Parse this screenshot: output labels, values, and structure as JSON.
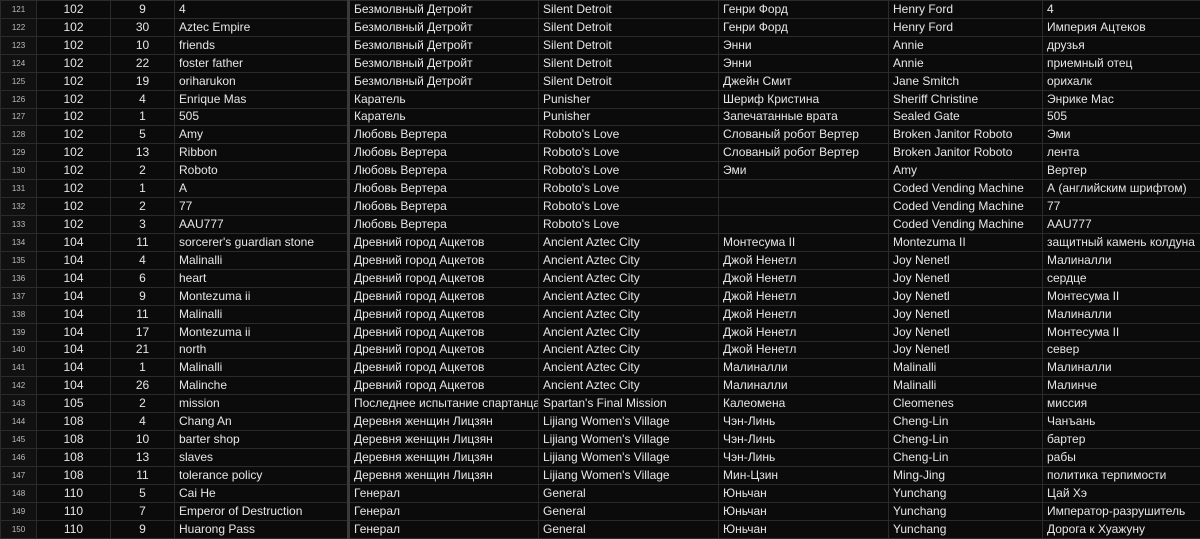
{
  "rows": [
    {
      "n": "121",
      "a": "102",
      "b": "9",
      "c": "4",
      "d": "Безмолвный Детройт",
      "e": "Silent Detroit",
      "f": "Генри Форд",
      "g": "Henry Ford",
      "h": "4"
    },
    {
      "n": "122",
      "a": "102",
      "b": "30",
      "c": "Aztec Empire",
      "d": "Безмолвный Детройт",
      "e": "Silent Detroit",
      "f": "Генри Форд",
      "g": "Henry Ford",
      "h": "Империя Ацтеков"
    },
    {
      "n": "123",
      "a": "102",
      "b": "10",
      "c": "friends",
      "d": "Безмолвный Детройт",
      "e": "Silent Detroit",
      "f": "Энни",
      "g": "Annie",
      "h": "друзья"
    },
    {
      "n": "124",
      "a": "102",
      "b": "22",
      "c": "foster father",
      "d": "Безмолвный Детройт",
      "e": "Silent Detroit",
      "f": "Энни",
      "g": "Annie",
      "h": "приемный отец"
    },
    {
      "n": "125",
      "a": "102",
      "b": "19",
      "c": "oriharukon",
      "d": "Безмолвный Детройт",
      "e": "Silent Detroit",
      "f": "Джейн Смит",
      "g": "Jane Smitch",
      "h": "орихалк"
    },
    {
      "n": "126",
      "a": "102",
      "b": "4",
      "c": "Enrique Mas",
      "d": "Каратель",
      "e": "Punisher",
      "f": "Шериф Кристина",
      "g": "Sheriff Christine",
      "h": "Энрике Мас"
    },
    {
      "n": "127",
      "a": "102",
      "b": "1",
      "c": "505",
      "d": "Каратель",
      "e": "Punisher",
      "f": "Запечатанные врата",
      "g": "Sealed Gate",
      "h": "505"
    },
    {
      "n": "128",
      "a": "102",
      "b": "5",
      "c": "Amy",
      "d": "Любовь Вертера",
      "e": "Roboto's Love",
      "f": "Слованый робот Вертер",
      "g": "Broken Janitor Roboto",
      "h": "Эми"
    },
    {
      "n": "129",
      "a": "102",
      "b": "13",
      "c": "Ribbon",
      "d": "Любовь Вертера",
      "e": "Roboto's Love",
      "f": "Слованый робот Вертер",
      "g": "Broken Janitor Roboto",
      "h": "лента"
    },
    {
      "n": "130",
      "a": "102",
      "b": "2",
      "c": "Roboto",
      "d": "Любовь Вертера",
      "e": "Roboto's Love",
      "f": "Эми",
      "g": "Amy",
      "h": "Вертер"
    },
    {
      "n": "131",
      "a": "102",
      "b": "1",
      "c": "A",
      "d": "Любовь Вертера",
      "e": "Roboto's Love",
      "f": "",
      "g": "Coded Vending Machine",
      "h": "А (английским шрифтом)"
    },
    {
      "n": "132",
      "a": "102",
      "b": "2",
      "c": "77",
      "d": "Любовь Вертера",
      "e": "Roboto's Love",
      "f": "",
      "g": "Coded Vending Machine",
      "h": "77"
    },
    {
      "n": "133",
      "a": "102",
      "b": "3",
      "c": "AAU777",
      "d": "Любовь Вертера",
      "e": "Roboto's Love",
      "f": "",
      "g": "Coded Vending Machine",
      "h": "AAU777"
    },
    {
      "n": "134",
      "a": "104",
      "b": "11",
      "c": "sorcerer's guardian stone",
      "d": "Древний город Ацкетов",
      "e": "Ancient Aztec City",
      "f": "Монтесума II",
      "g": "Montezuma II",
      "h": "защитный камень колдуна"
    },
    {
      "n": "135",
      "a": "104",
      "b": "4",
      "c": "Malinalli",
      "d": "Древний город Ацкетов",
      "e": "Ancient Aztec City",
      "f": "Джой Ненетл",
      "g": "Joy Nenetl",
      "h": "Малиналли"
    },
    {
      "n": "136",
      "a": "104",
      "b": "6",
      "c": "heart",
      "d": "Древний город Ацкетов",
      "e": "Ancient Aztec City",
      "f": "Джой Ненетл",
      "g": "Joy Nenetl",
      "h": "сердце"
    },
    {
      "n": "137",
      "a": "104",
      "b": "9",
      "c": "Montezuma ii",
      "d": "Древний город Ацкетов",
      "e": "Ancient Aztec City",
      "f": "Джой Ненетл",
      "g": "Joy Nenetl",
      "h": "Монтесума II"
    },
    {
      "n": "138",
      "a": "104",
      "b": "11",
      "c": "Malinalli",
      "d": "Древний город Ацкетов",
      "e": "Ancient Aztec City",
      "f": "Джой Ненетл",
      "g": "Joy Nenetl",
      "h": "Малиналли"
    },
    {
      "n": "139",
      "a": "104",
      "b": "17",
      "c": "Montezuma ii",
      "d": "Древний город Ацкетов",
      "e": "Ancient Aztec City",
      "f": "Джой Ненетл",
      "g": "Joy Nenetl",
      "h": "Монтесума II"
    },
    {
      "n": "140",
      "a": "104",
      "b": "21",
      "c": "north",
      "d": "Древний город Ацкетов",
      "e": "Ancient Aztec City",
      "f": "Джой Ненетл",
      "g": "Joy Nenetl",
      "h": "север"
    },
    {
      "n": "141",
      "a": "104",
      "b": "1",
      "c": "Malinalli",
      "d": "Древний город Ацкетов",
      "e": "Ancient Aztec City",
      "f": "Малиналли",
      "g": "Malinalli",
      "h": "Малиналли"
    },
    {
      "n": "142",
      "a": "104",
      "b": "26",
      "c": "Malinche",
      "d": "Древний город Ацкетов",
      "e": "Ancient Aztec City",
      "f": "Малиналли",
      "g": "Malinalli",
      "h": "Малинче"
    },
    {
      "n": "143",
      "a": "105",
      "b": "2",
      "c": "mission",
      "d": "Последнее испытание спартанца",
      "e": "Spartan's Final Mission",
      "f": "Калеомена",
      "g": "Cleomenes",
      "h": "миссия"
    },
    {
      "n": "144",
      "a": "108",
      "b": "4",
      "c": "Chang An",
      "d": "Деревня женщин Лицзян",
      "e": "Lijiang Women's Village",
      "f": "Чэн-Линь",
      "g": "Cheng-Lin",
      "h": "Чанъань"
    },
    {
      "n": "145",
      "a": "108",
      "b": "10",
      "c": "barter shop",
      "d": "Деревня женщин Лицзян",
      "e": "Lijiang Women's Village",
      "f": "Чэн-Линь",
      "g": "Cheng-Lin",
      "h": "бартер"
    },
    {
      "n": "146",
      "a": "108",
      "b": "13",
      "c": "slaves",
      "d": "Деревня женщин Лицзян",
      "e": "Lijiang Women's Village",
      "f": "Чэн-Линь",
      "g": "Cheng-Lin",
      "h": "рабы"
    },
    {
      "n": "147",
      "a": "108",
      "b": "11",
      "c": "tolerance policy",
      "d": "Деревня женщин Лицзян",
      "e": "Lijiang Women's Village",
      "f": "Мин-Цзин",
      "g": "Ming-Jing",
      "h": "политика терпимости"
    },
    {
      "n": "148",
      "a": "110",
      "b": "5",
      "c": "Cai He",
      "d": "Генерал",
      "e": "General",
      "f": "Юньчан",
      "g": "Yunchang",
      "h": "Цай Хэ"
    },
    {
      "n": "149",
      "a": "110",
      "b": "7",
      "c": "Emperor of Destruction",
      "d": "Генерал",
      "e": "General",
      "f": "Юньчан",
      "g": "Yunchang",
      "h": "Император-разрушитель"
    },
    {
      "n": "150",
      "a": "110",
      "b": "9",
      "c": "Huarong Pass",
      "d": "Генерал",
      "e": "General",
      "f": "Юньчан",
      "g": "Yunchang",
      "h": "Дорога к Хуажуну"
    }
  ]
}
